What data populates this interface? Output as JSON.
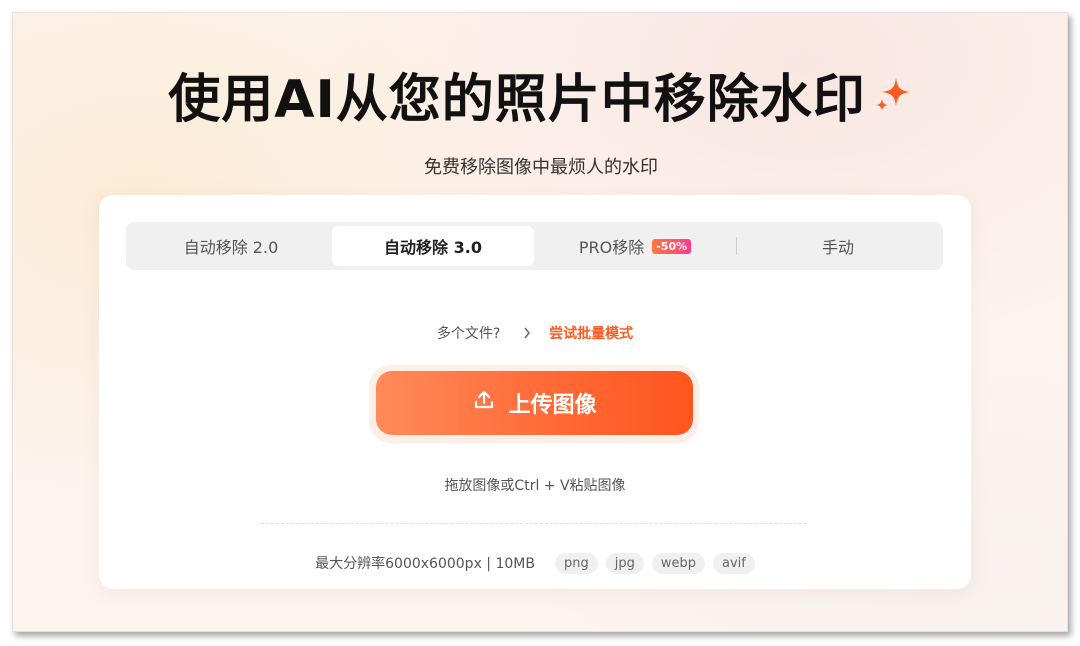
{
  "hero": {
    "title": "使用AI从您的照片中移除水印",
    "subtitle": "免费移除图像中最烦人的水印"
  },
  "tabs": [
    {
      "label": "自动移除 2.0",
      "active": false
    },
    {
      "label": "自动移除 3.0",
      "active": true
    },
    {
      "label": "PRO移除",
      "badge": "-50%",
      "active": false
    },
    {
      "label": "手动",
      "active": false
    }
  ],
  "batch": {
    "question": "多个文件?",
    "link": "尝试批量模式"
  },
  "upload": {
    "button_label": "上传图像",
    "hint": "拖放图像或Ctrl + V粘贴图像"
  },
  "limits": {
    "text": "最大分辨率6000x6000px | 10MB",
    "formats": [
      "png",
      "jpg",
      "webp",
      "avif"
    ]
  },
  "colors": {
    "accent": "#ff5a1f",
    "sparkle": "#ff5a1f"
  },
  "icons": {
    "sparkle": "sparkle-icon",
    "upload": "upload-icon",
    "chevron": "chevron-right-icon"
  }
}
